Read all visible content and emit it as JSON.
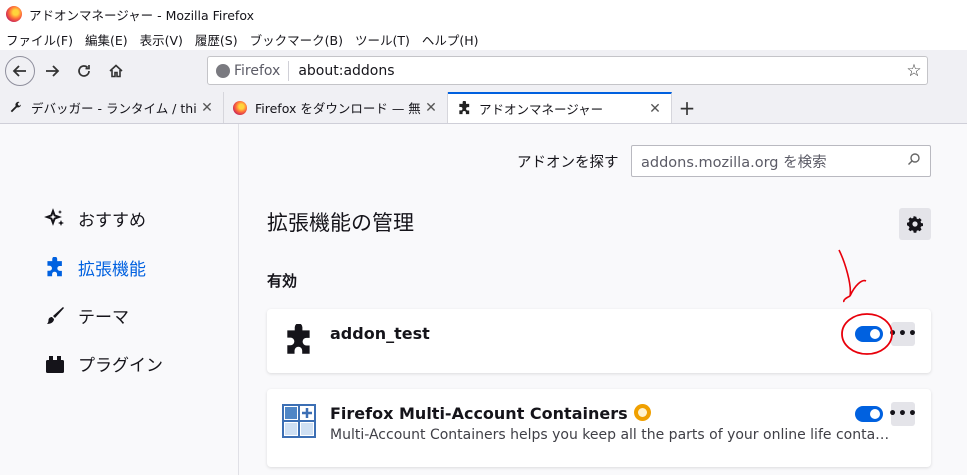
{
  "window": {
    "title": "アドオンマネージャー - Mozilla Firefox"
  },
  "menubar": [
    "ファイル(F)",
    "編集(E)",
    "表示(V)",
    "履歴(S)",
    "ブックマーク(B)",
    "ツール(T)",
    "ヘルプ(H)"
  ],
  "navbar": {
    "identity_label": "Firefox",
    "url": "about:addons"
  },
  "tabs": [
    {
      "label": "デバッガー - ランタイム / thi"
    },
    {
      "label": "Firefox をダウンロード — 無"
    },
    {
      "label": "アドオンマネージャー"
    }
  ],
  "sidebar": {
    "items": [
      {
        "label": "おすすめ",
        "icon": "sparkle-icon"
      },
      {
        "label": "拡張機能",
        "icon": "puzzle-icon",
        "selected": true
      },
      {
        "label": "テーマ",
        "icon": "brush-icon"
      },
      {
        "label": "プラグイン",
        "icon": "plugin-icon"
      }
    ]
  },
  "main": {
    "find_label": "アドオンを探す",
    "search_placeholder": "addons.mozilla.org を検索",
    "title": "拡張機能の管理",
    "section_enabled": "有効",
    "addons": [
      {
        "name": "addon_test",
        "description": "",
        "enabled": true
      },
      {
        "name": "Firefox Multi-Account Containers",
        "description": "Multi-Account Containers helps you keep all the parts of your online life contained in different tabs.",
        "enabled": true,
        "recommended": true
      }
    ]
  },
  "colors": {
    "accent": "#0061e0",
    "annotation": "#e8000b",
    "active_tab_line": "#0060df"
  }
}
